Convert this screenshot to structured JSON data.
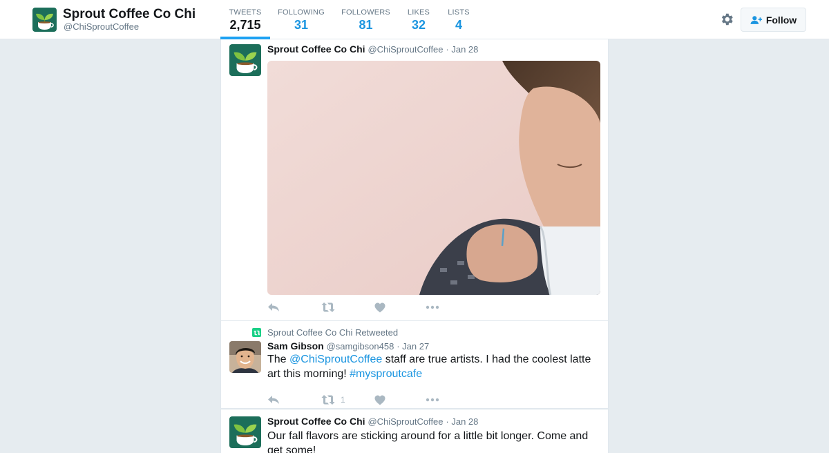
{
  "profile": {
    "name": "Sprout Coffee Co Chi",
    "handle": "@ChiSproutCoffee",
    "logo_icon": "sprout-coffee-cup-logo"
  },
  "stats": [
    {
      "label": "TWEETS",
      "value": "2,715",
      "active": true
    },
    {
      "label": "FOLLOWING",
      "value": "31",
      "active": false
    },
    {
      "label": "FOLLOWERS",
      "value": "81",
      "active": false
    },
    {
      "label": "LIKES",
      "value": "32",
      "active": false
    },
    {
      "label": "LISTS",
      "value": "4",
      "active": false
    }
  ],
  "toolbar": {
    "settings_icon": "gear-icon",
    "follow_label": "Follow"
  },
  "tweets": [
    {
      "name": "Sprout Coffee Co Chi",
      "handle": "@ChiSproutCoffee",
      "date": "· Jan 28",
      "has_photo": true,
      "retweet_count": "",
      "like_count": ""
    },
    {
      "retweet_context": "Sprout Coffee Co Chi Retweeted",
      "name": "Sam Gibson",
      "handle": "@samgibson458",
      "date": "· Jan 27",
      "text_before": "The ",
      "mention": "@ChiSproutCoffee",
      "text_after": " staff are true artists. I had the coolest latte art this morning! ",
      "hashtag": "#mysproutcafe",
      "retweet_count": "1",
      "like_count": ""
    },
    {
      "name": "Sprout Coffee Co Chi",
      "handle": "@ChiSproutCoffee",
      "date": "· Jan 28",
      "text": "Our fall flavors are sticking around for a little bit longer. Come and get some!"
    }
  ],
  "colors": {
    "accent": "#1da1f2",
    "link": "#1b95e0",
    "background": "#e6ecf0",
    "retweet_green": "#19cf86",
    "icon_gray": "#aab8c2"
  }
}
